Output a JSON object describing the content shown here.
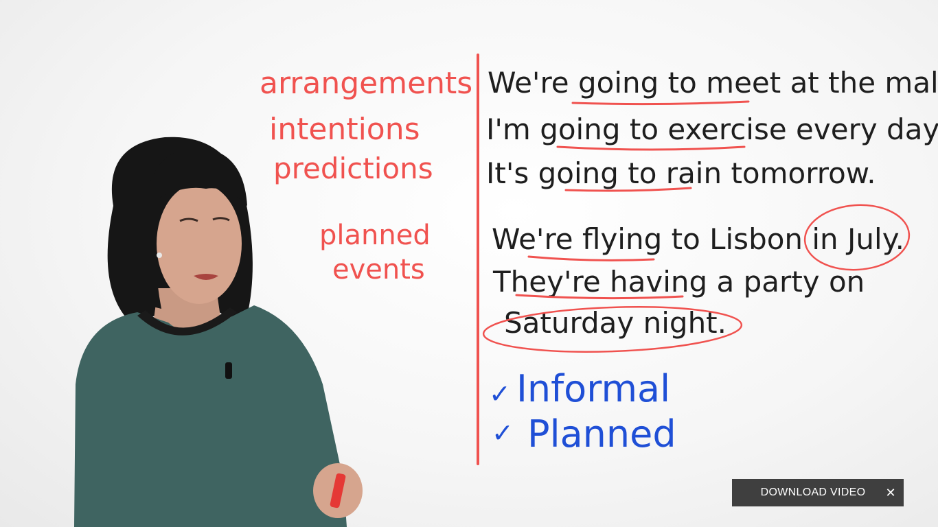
{
  "board": {
    "labels": {
      "arrangements": "arrangements",
      "intentions": "intentions",
      "predictions": "predictions",
      "planned": "planned",
      "events": "events"
    },
    "sentences": [
      "We're going to meet at the mall.",
      "I'm going to exercise every day.",
      "It's going to rain tomorrow.",
      "We're flying to Lisbon in July.",
      "They're having a party on",
      "Saturday night."
    ],
    "checklist": [
      {
        "mark": "✓",
        "text": "Informal"
      },
      {
        "mark": "✓",
        "text": "Planned"
      }
    ],
    "colors": {
      "red_marker": "#f0524f",
      "black_marker": "#1e1e1e",
      "blue_marker": "#1f4fd6"
    }
  },
  "download_bar": {
    "label": "DOWNLOAD VIDEO",
    "close_icon": "close-icon",
    "close_glyph": "✕"
  }
}
